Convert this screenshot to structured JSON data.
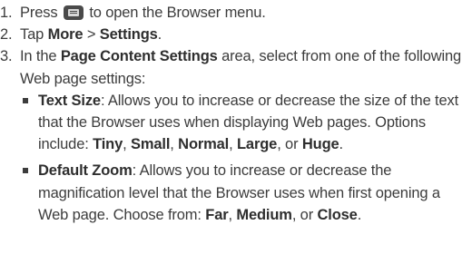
{
  "steps": [
    {
      "num": "1.",
      "text_before_icon": "Press",
      "icon": "menu-key-icon",
      "text_after_icon": "to open the Browser menu."
    },
    {
      "num": "2.",
      "t1": "Tap ",
      "b1": "More",
      "t2": " > ",
      "b2": "Settings",
      "t3": "."
    },
    {
      "num": "3.",
      "t1": "In the ",
      "b1": "Page Content Settings",
      "t2": " area, select from one of the following Web page settings:",
      "bullets": [
        {
          "title": "Text Size",
          "desc": ": Allows you to increase or decrease the size of the text that the Browser uses when displaying Web pages. Options include: ",
          "opt1": "Tiny",
          "sep1": ", ",
          "opt2": "Small",
          "sep2": ", ",
          "opt3": "Normal",
          "sep3": ", ",
          "opt4": "Large",
          "sep4": ", or ",
          "opt5": "Huge",
          "end": "."
        },
        {
          "title": "Default Zoom",
          "desc": ": Allows you to increase or decrease the magnification level that the Browser uses when first opening a Web page. Choose from: ",
          "opt1": "Far",
          "sep1": ", ",
          "opt2": "Medium",
          "sep2": ", or ",
          "opt3": "Close",
          "end": "."
        }
      ]
    }
  ]
}
